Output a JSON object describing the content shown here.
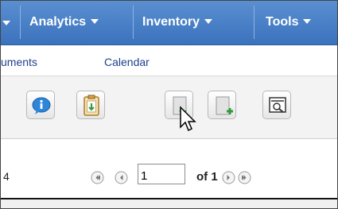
{
  "nav": {
    "items": [
      {
        "label": "Analytics"
      },
      {
        "label": "Inventory"
      },
      {
        "label": "Tools"
      }
    ]
  },
  "subnav": {
    "links": [
      {
        "label": "uments"
      },
      {
        "label": "Calendar"
      }
    ]
  },
  "toolbar": {
    "buttons": [
      {
        "icon": "info-icon"
      },
      {
        "icon": "clipboard-icon"
      },
      {
        "icon": "document-download-icon"
      },
      {
        "icon": "document-add-icon"
      },
      {
        "icon": "preview-icon"
      }
    ]
  },
  "pager": {
    "count_text": "4",
    "page_value": "1",
    "of_label": "of 1",
    "buttons": [
      "first-page-icon",
      "prev-page-icon",
      "next-page-icon",
      "last-page-icon"
    ]
  },
  "colors": {
    "nav_bg": "#3b72bd",
    "link": "#1f3f8c",
    "toolbar_bg": "#f3f3f3"
  }
}
